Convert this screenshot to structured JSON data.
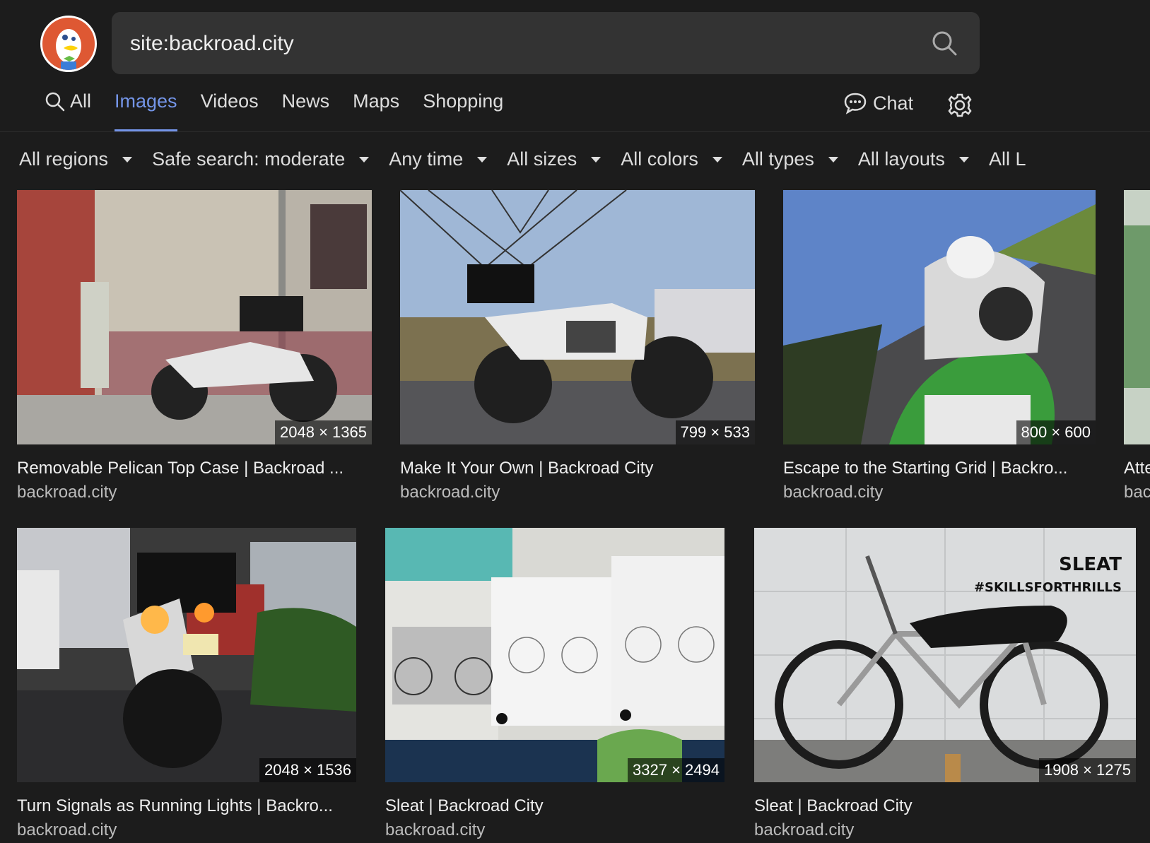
{
  "search": {
    "query": "site:backroad.city"
  },
  "tabs": [
    {
      "label": "All",
      "icon": "search-icon"
    },
    {
      "label": "Images"
    },
    {
      "label": "Videos"
    },
    {
      "label": "News"
    },
    {
      "label": "Maps"
    },
    {
      "label": "Shopping"
    }
  ],
  "active_tab": "Images",
  "chat": {
    "label": "Chat",
    "icon": "chat-bubble-icon"
  },
  "settings": {
    "icon": "gear-icon"
  },
  "filters": [
    {
      "label": "All regions"
    },
    {
      "label": "Safe search: moderate"
    },
    {
      "label": "Any time"
    },
    {
      "label": "All sizes"
    },
    {
      "label": "All colors"
    },
    {
      "label": "All types"
    },
    {
      "label": "All layouts"
    },
    {
      "label": "All L"
    }
  ],
  "results": [
    {
      "dims": "2048 × 1365",
      "title": "Removable Pelican Top Case | Backroad ...",
      "source": "backroad.city"
    },
    {
      "dims": "799 × 533",
      "title": "Make It Your Own | Backroad City",
      "source": "backroad.city"
    },
    {
      "dims": "800 × 600",
      "title": "Escape to the Starting Grid | Backro...",
      "source": "backroad.city"
    },
    {
      "dims": "",
      "title": "Atte",
      "source": "bac"
    },
    {
      "dims": "2048 × 1536",
      "title": "Turn Signals as Running Lights | Backro...",
      "source": "backroad.city"
    },
    {
      "dims": "3327 × 2494",
      "title": "Sleat | Backroad City",
      "source": "backroad.city"
    },
    {
      "dims": "1908 × 1275",
      "title": "Sleat | Backroad City",
      "source": "backroad.city",
      "overlay_line1": "SLEAT",
      "overlay_line2": "#SKILLSFORTHRILLS"
    }
  ],
  "colors": {
    "background": "#1c1c1c",
    "accent": "#7495e8",
    "search_bg": "#333333",
    "logo_orange": "#de5833"
  }
}
